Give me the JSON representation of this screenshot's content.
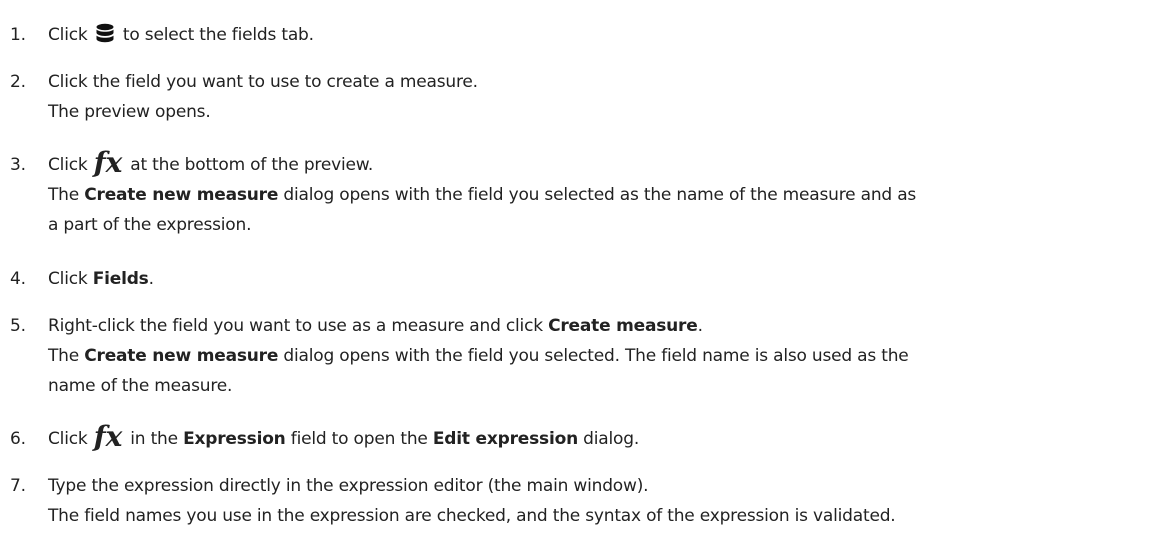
{
  "steps": [
    {
      "number": "1.",
      "lines": [
        [
          {
            "t": "Click "
          },
          {
            "icon": "database-icon"
          },
          {
            "t": " to select the fields tab."
          }
        ]
      ]
    },
    {
      "number": "2.",
      "lines": [
        [
          {
            "t": "Click the field you want to use to create a measure."
          }
        ],
        [
          {
            "t": "The preview opens."
          }
        ]
      ]
    },
    {
      "number": "3.",
      "lines": [
        [
          {
            "t": "Click "
          },
          {
            "icon": "fx-icon",
            "glyph": "fx"
          },
          {
            "t": " at the bottom of the preview."
          }
        ],
        [
          {
            "t": "The "
          },
          {
            "t": "Create new measure",
            "b": true
          },
          {
            "t": " dialog opens with the field you selected as the name of the measure and as"
          }
        ],
        [
          {
            "t": "a part of the expression."
          }
        ]
      ]
    },
    {
      "number": "4.",
      "lines": [
        [
          {
            "t": "Click "
          },
          {
            "t": "Fields",
            "b": true
          },
          {
            "t": "."
          }
        ]
      ]
    },
    {
      "number": "5.",
      "lines": [
        [
          {
            "t": "Right-click the field you want to use as a measure and click "
          },
          {
            "t": "Create measure",
            "b": true
          },
          {
            "t": "."
          }
        ],
        [
          {
            "t": "The "
          },
          {
            "t": "Create new measure",
            "b": true
          },
          {
            "t": " dialog opens with the field you selected. The field name is also used as the"
          }
        ],
        [
          {
            "t": "name of the measure."
          }
        ]
      ]
    },
    {
      "number": "6.",
      "lines": [
        [
          {
            "t": "Click "
          },
          {
            "icon": "fx-icon",
            "glyph": "fx"
          },
          {
            "t": " in the "
          },
          {
            "t": "Expression",
            "b": true
          },
          {
            "t": " field to open the "
          },
          {
            "t": "Edit expression",
            "b": true
          },
          {
            "t": " dialog."
          }
        ]
      ]
    },
    {
      "number": "7.",
      "lines": [
        [
          {
            "t": "Type the expression directly in the expression editor (the main window)."
          }
        ],
        [
          {
            "t": "The field names you use in the expression are checked, and the syntax of the expression is validated."
          }
        ]
      ]
    }
  ]
}
